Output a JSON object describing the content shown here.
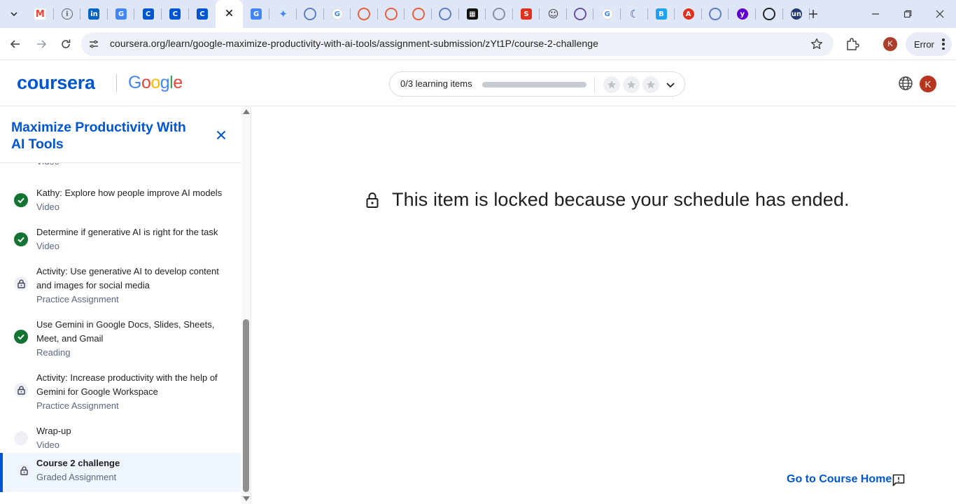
{
  "browser": {
    "tabs": [
      {
        "icon": "gmail-icon",
        "color": "#ea4335",
        "glyph": "M"
      },
      {
        "icon": "info-icon",
        "color": "#5f6368",
        "glyph": "i"
      },
      {
        "icon": "linkedin-icon",
        "color": "#0a66c2",
        "glyph": "in"
      },
      {
        "icon": "translate-icon",
        "color": "#4285f4",
        "glyph": "G"
      },
      {
        "icon": "coursera-c-icon",
        "color": "#0056d2",
        "glyph": "C"
      },
      {
        "icon": "coursera-c-icon",
        "color": "#0056d2",
        "glyph": "C"
      },
      {
        "icon": "coursera-c-icon",
        "color": "#0056d2",
        "glyph": "C"
      },
      {
        "icon": "close-icon",
        "color": "#333333",
        "glyph": "✕",
        "active": true
      },
      {
        "icon": "translate-icon",
        "color": "#4285f4",
        "glyph": "G"
      },
      {
        "icon": "gemini-icon",
        "color": "#4285f4",
        "glyph": "✦"
      },
      {
        "icon": "globe-ring-icon",
        "color": "#5b7fc7",
        "glyph": "≡"
      },
      {
        "icon": "google-g-icon",
        "color": "#4285f4",
        "glyph": "G"
      },
      {
        "icon": "orange-ring-icon",
        "color": "#e8603c",
        "glyph": "○"
      },
      {
        "icon": "orange-ring-icon",
        "color": "#e8603c",
        "glyph": "○"
      },
      {
        "icon": "orange-ring-icon",
        "color": "#e8603c",
        "glyph": "○"
      },
      {
        "icon": "globe-ring-icon",
        "color": "#5b7fc7",
        "glyph": "≡"
      },
      {
        "icon": "dark-square-icon",
        "color": "#111111",
        "glyph": "▦"
      },
      {
        "icon": "code-ring-icon",
        "color": "#8a8fa0",
        "glyph": "<>"
      },
      {
        "icon": "s-icon",
        "color": "#e0301e",
        "glyph": "S"
      },
      {
        "icon": "copilot-icon",
        "color": "#333333",
        "glyph": "☺"
      },
      {
        "icon": "b-ring-icon",
        "color": "#6a4fa3",
        "glyph": "B"
      },
      {
        "icon": "google-g-icon",
        "color": "#4285f4",
        "glyph": "G"
      },
      {
        "icon": "moon-icon",
        "color": "#2c4fa3",
        "glyph": "☾"
      },
      {
        "icon": "b-square-icon",
        "color": "#1da1f2",
        "glyph": "B"
      },
      {
        "icon": "a-circle-icon",
        "color": "#e0301e",
        "glyph": "A"
      },
      {
        "icon": "globe-ring-icon",
        "color": "#5b7fc7",
        "glyph": "≡"
      },
      {
        "icon": "yahoo-icon",
        "color": "#6001d2",
        "glyph": "y"
      },
      {
        "icon": "x-ring-icon",
        "color": "#222222",
        "glyph": "X"
      },
      {
        "icon": "un-icon",
        "color": "#1f3a6e",
        "glyph": "un"
      }
    ],
    "url": "coursera.org/learn/google-maximize-productivity-with-ai-tools/assignment-submission/zYt1P/course-2-challenge",
    "profile_initial": "K",
    "error_label": "Error"
  },
  "header": {
    "logo_text": "coursera",
    "partner_letters": [
      "G",
      "o",
      "o",
      "g",
      "l",
      "e"
    ],
    "progress_text": "0/3 learning items",
    "progress_fraction": 0,
    "avatar_initial": "K"
  },
  "sidebar": {
    "title": "Maximize Productivity With AI Tools",
    "partial_type": "Video",
    "items": [
      {
        "label": "Kathy: Explore how people improve AI models",
        "type": "Video",
        "status": "done"
      },
      {
        "label": "Determine if generative AI is right for the task",
        "type": "Video",
        "status": "done"
      },
      {
        "label": "Activity: Use generative AI to develop content and images for social media",
        "type": "Practice Assignment",
        "status": "locked"
      },
      {
        "label": "Use Gemini in Google Docs, Slides, Sheets, Meet, and Gmail",
        "type": "Reading",
        "status": "done"
      },
      {
        "label": "Activity: Increase productivity with the help of Gemini for Google Workspace",
        "type": "Practice Assignment",
        "status": "locked"
      },
      {
        "label": "Wrap-up",
        "type": "Video",
        "status": "pending"
      },
      {
        "label": "Course 2 challenge",
        "type": "Graded Assignment",
        "status": "locked",
        "active": true
      }
    ]
  },
  "main": {
    "locked_message": "This item is locked because your schedule has ended.",
    "go_home": "Go to Course Home"
  }
}
